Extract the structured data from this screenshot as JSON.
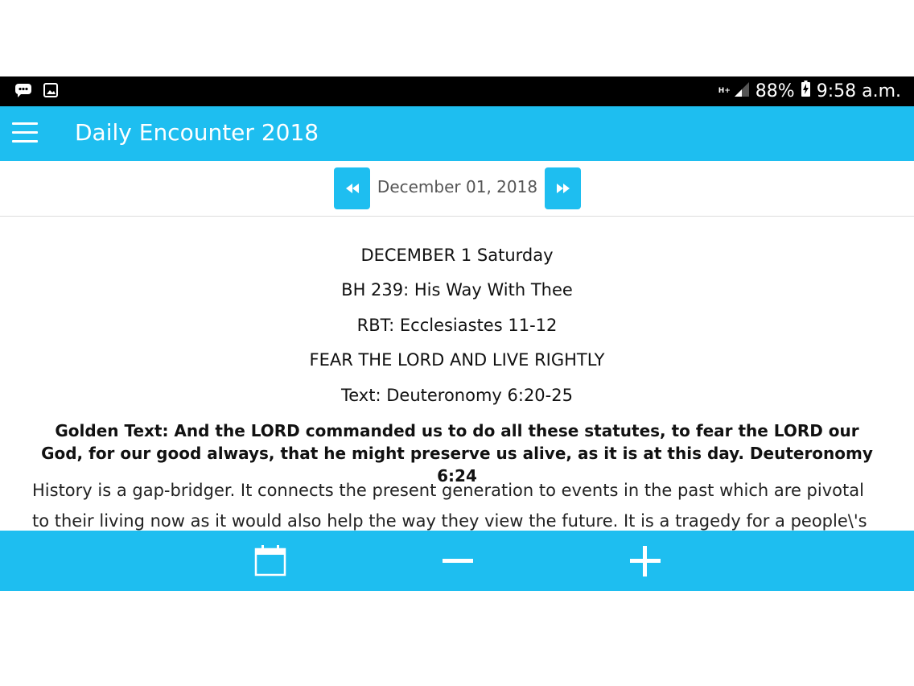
{
  "status_bar": {
    "network": "H+",
    "battery": "88%",
    "time": "9:58 a.m."
  },
  "app_bar": {
    "title": "Daily Encounter 2018"
  },
  "date_nav": {
    "date": "December 01, 2018"
  },
  "content": {
    "day": "DECEMBER 1 Saturday",
    "hymn": "BH 239: His Way With Thee",
    "reading": "RBT: Ecclesiastes 11-12",
    "topic": "FEAR THE LORD AND LIVE RIGHTLY",
    "text": "Text: Deuteronomy 6:20-25",
    "golden_text": "Golden Text: And the LORD commanded us to do all these statutes, to fear the LORD our God, for our good always, that he might preserve us alive, as it is at this day. Deuteronomy 6:24",
    "body": "History is a gap-bridger. It connects the present generation to events in the past which are pivotal to their living now as it would also help the way they view the future. It is a tragedy for a people\\'s history"
  },
  "colors": {
    "accent": "#1ebef0",
    "status_bar": "#000000"
  }
}
